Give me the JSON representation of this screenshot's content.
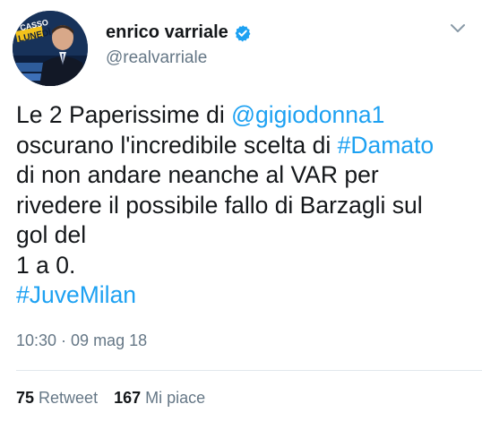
{
  "user": {
    "display_name": "enrico varriale",
    "handle": "@realvarriale",
    "avatar_text": [
      "CASSO",
      "LUNEDÌ"
    ]
  },
  "tweet": {
    "lines": [
      [
        {
          "text": "Le 2 Paperissime di ",
          "type": "text"
        },
        {
          "text": "@gigiodonna1",
          "type": "mention"
        }
      ],
      [
        {
          "text": "oscurano l'incredibile scelta di ",
          "type": "text"
        },
        {
          "text": "#Damato",
          "type": "hashtag"
        }
      ],
      [
        {
          "text": "di non andare neanche al VAR per",
          "type": "text"
        }
      ],
      [
        {
          "text": "rivedere il possibile fallo di Barzagli sul",
          "type": "text"
        }
      ],
      [
        {
          "text": "gol del",
          "type": "text"
        }
      ],
      [
        {
          "text": "1 a 0.",
          "type": "text"
        }
      ],
      [
        {
          "text": "#JuveMilan",
          "type": "hashtag"
        }
      ]
    ],
    "timestamp": "10:30 · 09 mag 18"
  },
  "stats": {
    "retweets_count": "75",
    "retweets_label": "Retweet",
    "likes_count": "167",
    "likes_label": "Mi piace"
  },
  "colors": {
    "link": "#1da1f2",
    "secondary_text": "#657786",
    "primary_text": "#14171a",
    "divider": "#e1e8ed",
    "verified": "#1da1f2"
  },
  "icons": {
    "verified": "verified-badge-icon",
    "chevron": "chevron-down-icon"
  }
}
